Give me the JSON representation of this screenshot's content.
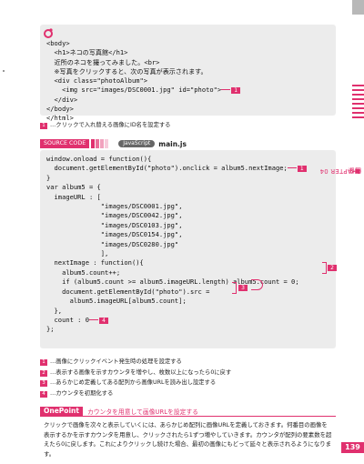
{
  "listing1": {
    "lines": [
      "<body>",
      "  <h1>ネコの写真館</h1>",
      "  近所のネコを撮ってみました。<br>",
      "  ※写真をクリックすると、次の写真が表示されます。",
      "  <div class=\"photoAlbum\">",
      "    <img src=\"images/DSC0001.jpg\" id=\"photo\">",
      "  </div>",
      "</body>",
      "</html>"
    ],
    "marker": "1"
  },
  "note1": {
    "num": "1",
    "text": "…クリックで入れ替える画像にID名を設定する"
  },
  "source_header": {
    "label": "SOURCE CODE",
    "lang": "JavaScript",
    "file": "main.js"
  },
  "listing2": {
    "lines": [
      "window.onload = function(){",
      "  document.getElementById(\"photo\").onclick = album5.nextImage;",
      "}",
      "var album5 = {",
      "  imageURL : [",
      "              \"images/DSC0001.jpg\",",
      "              \"images/DSC0042.jpg\",",
      "              \"images/DSC0103.jpg\",",
      "              \"images/DSC0154.jpg\",",
      "              \"images/DSC0280.jpg\"",
      "              ],",
      "  nextImage : function(){",
      "    album5.count++;",
      "    if (album5.count >= album5.imageURL.length) album5.count = 0;",
      "    document.getElementById(\"photo\").src =",
      "      album5.imageURL[album5.count];",
      "  },",
      "  count : 0",
      "};"
    ],
    "markers": [
      "1",
      "2",
      "3",
      "4"
    ]
  },
  "notes": [
    {
      "num": "1",
      "text": "…画像にクリックイベント発生時の処理を設定する"
    },
    {
      "num": "2",
      "text": "…表示する画像を示すカウンタを増やし、枚数以上になったら0に戻す"
    },
    {
      "num": "3",
      "text": "…あらかじめ定義してある配列から画像URLを読み出し設定する"
    },
    {
      "num": "4",
      "text": "…カウンタを初期化する"
    }
  ],
  "onepoint": {
    "label": "OnePoint",
    "title": "カウンタを用意して画像URLを設定する",
    "body": "クリックで画像を次々と表示していくには、あらかじめ配列に画像URLを定義しておきます。何番目の画像を表示するかを示すカウンタを用意し、クリックされたら1ずつ増やしていきます。カウンタが配列の要素数を超えたら0に戻します。これによりクリックし続けた場合、最初の画像にもどって延々と表示されるようになります。"
  },
  "side": {
    "chapter": "CHAPTER 04",
    "section": "画像"
  },
  "page_number": "139",
  "colors": {
    "accent": "#e0306e",
    "code_bg": "#ececec"
  }
}
